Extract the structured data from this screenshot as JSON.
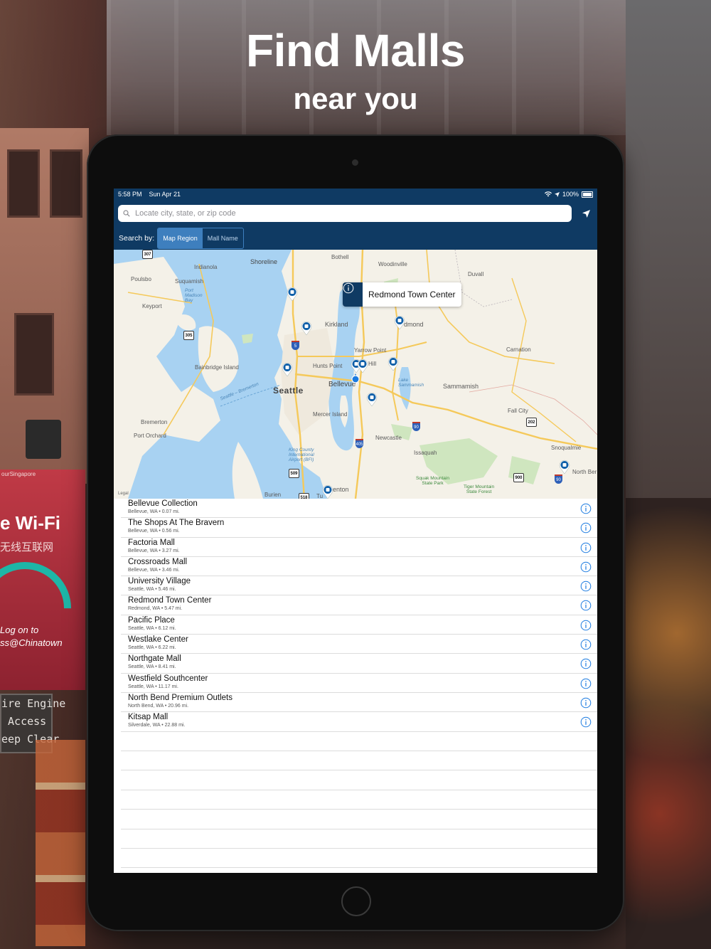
{
  "headline": {
    "title": "Find Malls",
    "subtitle": "near you"
  },
  "background_signs": {
    "wifi": "e Wi-Fi",
    "wifi_cn": "无线互联网",
    "logon": "Log on to\nss@Chinatown",
    "engine": "ire Engine\n Access\neep Clear",
    "brand": "ourSingapore"
  },
  "status_bar": {
    "time": "5:58 PM",
    "date": "Sun Apr 21",
    "battery": "100%"
  },
  "search": {
    "placeholder": "Locate city, state, or zip code",
    "search_icon": "search-icon",
    "location_icon": "location-arrow-icon"
  },
  "search_by": {
    "label": "Search by:",
    "options": [
      "Map Region",
      "Mall Name"
    ],
    "selected": "Map Region"
  },
  "map": {
    "callout": "Redmond Town Center",
    "legal": "Legal",
    "labels": {
      "bothell": "Bothell",
      "woodinville": "Woodinville",
      "shoreline": "Shoreline",
      "duvall": "Duvall",
      "indianola": "Indianola",
      "poulsbo": "Poulsbo",
      "suquamish": "Suquamish",
      "port_madison_bay": "Port\nMadison\nBay",
      "keyport": "Keyport",
      "kirkland": "Kirkland",
      "redmond": "dmond",
      "yarrow_point": "Yarrow Point",
      "carnation": "Carnation",
      "hunts_point": "Hunts Point",
      "hill": "Hill",
      "bainbridge_island": "Bainbridge Island",
      "seattle": "Seattle",
      "bellevue": "Bellevue",
      "lake_sammamish": "Lake\nSammamish",
      "sammamish": "Sammamish",
      "seattle_bremerton": "Seattle – Bremerton",
      "bremerton": "Bremerton",
      "fall_city": "Fall City",
      "mercer_island": "Mercer Island",
      "port_orchard": "Port Orchard",
      "newcastle": "Newcastle",
      "issaquah": "Issaquah",
      "snoqualmie": "Snoqualmie",
      "north_bend": "North Ber",
      "king_county_airport": "King County\nInternational\nAirport (BFI)",
      "squak_mountain": "Squak Mountain\nState Park",
      "tiger_mountain": "Tiger Mountain\nState Forest",
      "burien": "Burien",
      "renton": "enton",
      "tukwila": "Tu"
    },
    "shields": {
      "r307": "307",
      "r305": "305",
      "r202": "202",
      "r509": "509",
      "r900": "900",
      "r518": "518",
      "i5": "5",
      "i90a": "90",
      "i405": "405",
      "i90b": "90"
    }
  },
  "malls": [
    {
      "name": "Bellevue Collection",
      "location": "Bellevue, WA",
      "distance": "0.07 mi."
    },
    {
      "name": "The Shops At The Bravern",
      "location": "Bellevue, WA",
      "distance": "0.56 mi."
    },
    {
      "name": "Factoria Mall",
      "location": "Bellevue, WA",
      "distance": "3.27 mi."
    },
    {
      "name": "Crossroads Mall",
      "location": "Bellevue, WA",
      "distance": "3.46 mi."
    },
    {
      "name": "University Village",
      "location": "Seattle, WA",
      "distance": "5.46 mi."
    },
    {
      "name": "Redmond Town Center",
      "location": "Redmond, WA",
      "distance": "5.47 mi."
    },
    {
      "name": "Pacific Place",
      "location": "Seattle, WA",
      "distance": "6.12 mi."
    },
    {
      "name": "Westlake Center",
      "location": "Seattle, WA",
      "distance": "6.22 mi."
    },
    {
      "name": "Northgate Mall",
      "location": "Seattle, WA",
      "distance": "8.41 mi."
    },
    {
      "name": "Westfield Southcenter",
      "location": "Seattle, WA",
      "distance": "11.17 mi."
    },
    {
      "name": "North Bend Premium Outlets",
      "location": "North Bend, WA",
      "distance": "20.96 mi."
    },
    {
      "name": "Kitsap Mall",
      "location": "Silverdale, WA",
      "distance": "22.88 mi."
    }
  ],
  "colors": {
    "nav_blue": "#0f3a63",
    "accent_blue": "#3e7fbe",
    "info_blue": "#1a7ae0",
    "water": "#a8d2f2",
    "land": "#f4f1e8"
  }
}
